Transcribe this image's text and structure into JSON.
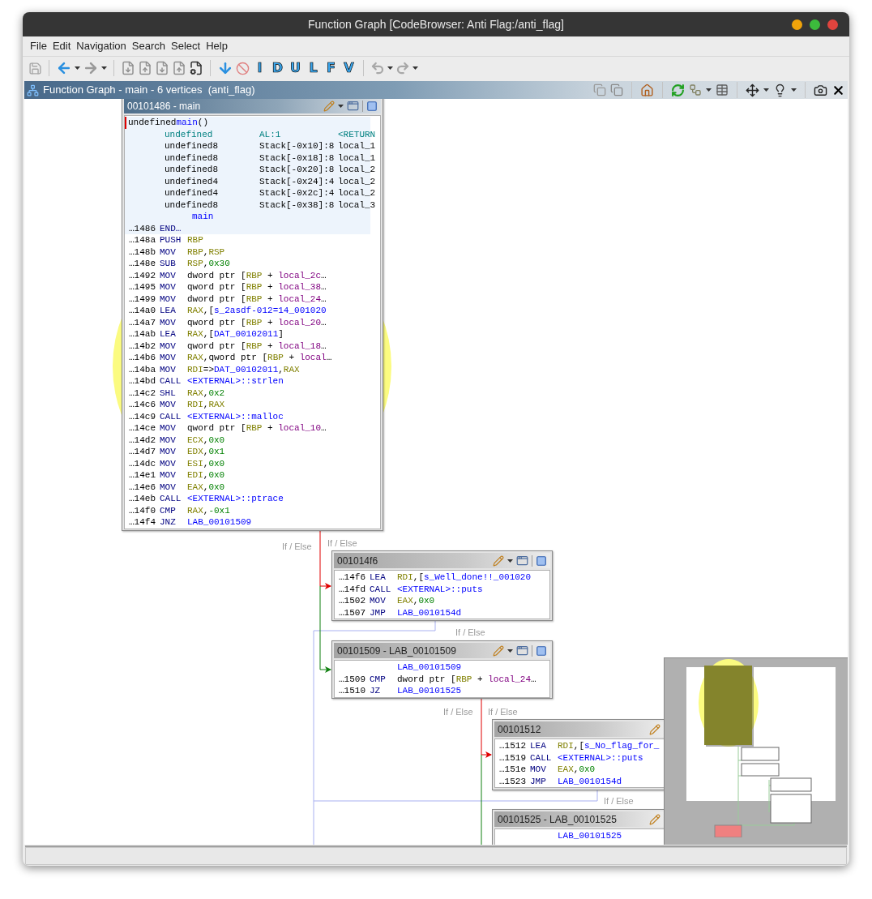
{
  "window": {
    "title": "Function Graph [CodeBrowser: Anti Flag:/anti_flag]"
  },
  "menu": [
    {
      "label": "File"
    },
    {
      "label": "Edit"
    },
    {
      "label": "Navigation"
    },
    {
      "label": "Search"
    },
    {
      "label": "Select"
    },
    {
      "label": "Help"
    }
  ],
  "toolbar": {
    "save_enabled": false,
    "forward_enabled": false,
    "undo_enabled": false,
    "redo_enabled": false,
    "letters": [
      "I",
      "D",
      "U",
      "L",
      "F",
      "V"
    ]
  },
  "panel": {
    "title": "Function Graph - main - 6 vertices  (anti_flag)"
  },
  "nodes": [
    {
      "title": "00101486 - main",
      "selected": true,
      "clipped": false,
      "signature": {
        "head": [
          {
            "kind": "text",
            "text": "undefined"
          },
          {
            "kind": "label",
            "text": "main"
          },
          {
            "kind": "text",
            "text": "()"
          }
        ],
        "params": [
          {
            "kind": "return",
            "type": "undefined",
            "storage": "AL:1",
            "name": "<RETURN"
          },
          {
            "kind": "param",
            "type": "undefined8",
            "storage": "Stack[-0x10]:8",
            "name": "local_1"
          },
          {
            "kind": "param",
            "type": "undefined8",
            "storage": "Stack[-0x18]:8",
            "name": "local_1"
          },
          {
            "kind": "param",
            "type": "undefined8",
            "storage": "Stack[-0x20]:8",
            "name": "local_2"
          },
          {
            "kind": "param",
            "type": "undefined4",
            "storage": "Stack[-0x24]:4",
            "name": "local_2"
          },
          {
            "kind": "param",
            "type": "undefined4",
            "storage": "Stack[-0x2c]:4",
            "name": "local_2"
          },
          {
            "kind": "param",
            "type": "undefined8",
            "storage": "Stack[-0x38]:8",
            "name": "local_3"
          }
        ],
        "label": "main",
        "end_addr": "…1486",
        "end_mnemonic": "END…"
      },
      "lines": [
        {
          "addr": "…148a",
          "mnemonic": "PUSH",
          "operands": [
            {
              "kind": "reg",
              "text": "RBP"
            }
          ]
        },
        {
          "addr": "…148b",
          "mnemonic": "MOV",
          "operands": [
            {
              "kind": "reg",
              "text": "RBP"
            },
            {
              "kind": "text",
              "text": ","
            },
            {
              "kind": "reg",
              "text": "RSP"
            }
          ]
        },
        {
          "addr": "…148e",
          "mnemonic": "SUB",
          "operands": [
            {
              "kind": "reg",
              "text": "RSP"
            },
            {
              "kind": "text",
              "text": ","
            },
            {
              "kind": "num",
              "text": "0x30"
            }
          ]
        },
        {
          "addr": "…1492",
          "mnemonic": "MOV",
          "operands": [
            {
              "kind": "text",
              "text": "dword ptr ["
            },
            {
              "kind": "reg",
              "text": "RBP"
            },
            {
              "kind": "text",
              "text": " + "
            },
            {
              "kind": "local",
              "text": "local_2c"
            },
            {
              "kind": "text",
              "text": "…"
            }
          ]
        },
        {
          "addr": "…1495",
          "mnemonic": "MOV",
          "operands": [
            {
              "kind": "text",
              "text": "qword ptr ["
            },
            {
              "kind": "reg",
              "text": "RBP"
            },
            {
              "kind": "text",
              "text": " + "
            },
            {
              "kind": "local",
              "text": "local_38"
            },
            {
              "kind": "text",
              "text": "…"
            }
          ]
        },
        {
          "addr": "…1499",
          "mnemonic": "MOV",
          "operands": [
            {
              "kind": "text",
              "text": "dword ptr ["
            },
            {
              "kind": "reg",
              "text": "RBP"
            },
            {
              "kind": "text",
              "text": " + "
            },
            {
              "kind": "local",
              "text": "local_24"
            },
            {
              "kind": "text",
              "text": "…"
            }
          ]
        },
        {
          "addr": "…14a0",
          "mnemonic": "LEA",
          "operands": [
            {
              "kind": "reg",
              "text": "RAX"
            },
            {
              "kind": "text",
              "text": ",["
            },
            {
              "kind": "label",
              "text": "s_2asdf-012=14_001020"
            }
          ]
        },
        {
          "addr": "…14a7",
          "mnemonic": "MOV",
          "operands": [
            {
              "kind": "text",
              "text": "qword ptr ["
            },
            {
              "kind": "reg",
              "text": "RBP"
            },
            {
              "kind": "text",
              "text": " + "
            },
            {
              "kind": "local",
              "text": "local_20"
            },
            {
              "kind": "text",
              "text": "…"
            }
          ]
        },
        {
          "addr": "…14ab",
          "mnemonic": "LEA",
          "operands": [
            {
              "kind": "reg",
              "text": "RAX"
            },
            {
              "kind": "text",
              "text": ",["
            },
            {
              "kind": "label",
              "text": "DAT_00102011"
            },
            {
              "kind": "text",
              "text": "]"
            }
          ]
        },
        {
          "addr": "…14b2",
          "mnemonic": "MOV",
          "operands": [
            {
              "kind": "text",
              "text": "qword ptr ["
            },
            {
              "kind": "reg",
              "text": "RBP"
            },
            {
              "kind": "text",
              "text": " + "
            },
            {
              "kind": "local",
              "text": "local_18"
            },
            {
              "kind": "text",
              "text": "…"
            }
          ]
        },
        {
          "addr": "…14b6",
          "mnemonic": "MOV",
          "operands": [
            {
              "kind": "reg",
              "text": "RAX"
            },
            {
              "kind": "text",
              "text": ",qword ptr ["
            },
            {
              "kind": "reg",
              "text": "RBP"
            },
            {
              "kind": "text",
              "text": " + "
            },
            {
              "kind": "local",
              "text": "local"
            },
            {
              "kind": "text",
              "text": "…"
            }
          ]
        },
        {
          "addr": "…14ba",
          "mnemonic": "MOV",
          "operands": [
            {
              "kind": "reg",
              "text": "RDI"
            },
            {
              "kind": "text",
              "text": "=>"
            },
            {
              "kind": "label",
              "text": "DAT_00102011"
            },
            {
              "kind": "text",
              "text": ","
            },
            {
              "kind": "reg",
              "text": "RAX"
            }
          ]
        },
        {
          "addr": "…14bd",
          "mnemonic": "CALL",
          "operands": [
            {
              "kind": "label",
              "text": "<EXTERNAL>::strlen"
            }
          ]
        },
        {
          "addr": "…14c2",
          "mnemonic": "SHL",
          "operands": [
            {
              "kind": "reg",
              "text": "RAX"
            },
            {
              "kind": "text",
              "text": ","
            },
            {
              "kind": "num",
              "text": "0x2"
            }
          ]
        },
        {
          "addr": "…14c6",
          "mnemonic": "MOV",
          "operands": [
            {
              "kind": "reg",
              "text": "RDI"
            },
            {
              "kind": "text",
              "text": ","
            },
            {
              "kind": "reg",
              "text": "RAX"
            }
          ]
        },
        {
          "addr": "…14c9",
          "mnemonic": "CALL",
          "operands": [
            {
              "kind": "label",
              "text": "<EXTERNAL>::malloc"
            }
          ]
        },
        {
          "addr": "…14ce",
          "mnemonic": "MOV",
          "operands": [
            {
              "kind": "text",
              "text": "qword ptr ["
            },
            {
              "kind": "reg",
              "text": "RBP"
            },
            {
              "kind": "text",
              "text": " + "
            },
            {
              "kind": "local",
              "text": "local_10"
            },
            {
              "kind": "text",
              "text": "…"
            }
          ]
        },
        {
          "addr": "…14d2",
          "mnemonic": "MOV",
          "operands": [
            {
              "kind": "reg",
              "text": "ECX"
            },
            {
              "kind": "text",
              "text": ","
            },
            {
              "kind": "num",
              "text": "0x0"
            }
          ]
        },
        {
          "addr": "…14d7",
          "mnemonic": "MOV",
          "operands": [
            {
              "kind": "reg",
              "text": "EDX"
            },
            {
              "kind": "text",
              "text": ","
            },
            {
              "kind": "num",
              "text": "0x1"
            }
          ]
        },
        {
          "addr": "…14dc",
          "mnemonic": "MOV",
          "operands": [
            {
              "kind": "reg",
              "text": "ESI"
            },
            {
              "kind": "text",
              "text": ","
            },
            {
              "kind": "num",
              "text": "0x0"
            }
          ]
        },
        {
          "addr": "…14e1",
          "mnemonic": "MOV",
          "operands": [
            {
              "kind": "reg",
              "text": "EDI"
            },
            {
              "kind": "text",
              "text": ","
            },
            {
              "kind": "num",
              "text": "0x0"
            }
          ]
        },
        {
          "addr": "…14e6",
          "mnemonic": "MOV",
          "operands": [
            {
              "kind": "reg",
              "text": "EAX"
            },
            {
              "kind": "text",
              "text": ","
            },
            {
              "kind": "num",
              "text": "0x0"
            }
          ]
        },
        {
          "addr": "…14eb",
          "mnemonic": "CALL",
          "operands": [
            {
              "kind": "label",
              "text": "<EXTERNAL>::ptrace"
            }
          ]
        },
        {
          "addr": "…14f0",
          "mnemonic": "CMP",
          "operands": [
            {
              "kind": "reg",
              "text": "RAX"
            },
            {
              "kind": "text",
              "text": ","
            },
            {
              "kind": "num",
              "text": "-0x1"
            }
          ]
        },
        {
          "addr": "…14f4",
          "mnemonic": "JNZ",
          "operands": [
            {
              "kind": "label",
              "text": "LAB_00101509"
            }
          ]
        }
      ]
    },
    {
      "title": "001014f6",
      "selected": false,
      "clipped": false,
      "lines": [
        {
          "addr": "…14f6",
          "mnemonic": "LEA",
          "operands": [
            {
              "kind": "reg",
              "text": "RDI"
            },
            {
              "kind": "text",
              "text": ",["
            },
            {
              "kind": "label",
              "text": "s_Well_done!!_001020"
            }
          ]
        },
        {
          "addr": "…14fd",
          "mnemonic": "CALL",
          "operands": [
            {
              "kind": "label",
              "text": "<EXTERNAL>::puts"
            }
          ]
        },
        {
          "addr": "…1502",
          "mnemonic": "MOV",
          "operands": [
            {
              "kind": "reg",
              "text": "EAX"
            },
            {
              "kind": "text",
              "text": ","
            },
            {
              "kind": "num",
              "text": "0x0"
            }
          ]
        },
        {
          "addr": "…1507",
          "mnemonic": "JMP",
          "operands": [
            {
              "kind": "label",
              "text": "LAB_0010154d"
            }
          ]
        }
      ]
    },
    {
      "title": "00101509 - LAB_00101509",
      "selected": false,
      "clipped": false,
      "lines": [
        {
          "operands": [
            {
              "kind": "label",
              "text": "LAB_00101509"
            }
          ]
        },
        {
          "addr": "…1509",
          "mnemonic": "CMP",
          "operands": [
            {
              "kind": "text",
              "text": "dword ptr ["
            },
            {
              "kind": "reg",
              "text": "RBP"
            },
            {
              "kind": "text",
              "text": " + "
            },
            {
              "kind": "local",
              "text": "local_24"
            },
            {
              "kind": "text",
              "text": "…"
            }
          ]
        },
        {
          "addr": "…1510",
          "mnemonic": "JZ",
          "operands": [
            {
              "kind": "label",
              "text": "LAB_00101525"
            }
          ]
        }
      ]
    },
    {
      "title": "00101512",
      "selected": false,
      "clipped": true,
      "lines": [
        {
          "addr": "…1512",
          "mnemonic": "LEA",
          "operands": [
            {
              "kind": "reg",
              "text": "RDI"
            },
            {
              "kind": "text",
              "text": ",["
            },
            {
              "kind": "label",
              "text": "s_No_flag_for_"
            }
          ]
        },
        {
          "addr": "…1519",
          "mnemonic": "CALL",
          "operands": [
            {
              "kind": "label",
              "text": "<EXTERNAL>::puts"
            }
          ]
        },
        {
          "addr": "…151e",
          "mnemonic": "MOV",
          "operands": [
            {
              "kind": "reg",
              "text": "EAX"
            },
            {
              "kind": "text",
              "text": ","
            },
            {
              "kind": "num",
              "text": "0x0"
            }
          ]
        },
        {
          "addr": "…1523",
          "mnemonic": "JMP",
          "operands": [
            {
              "kind": "label",
              "text": "LAB_0010154d"
            }
          ]
        }
      ]
    },
    {
      "title": "00101525 - LAB_00101525",
      "selected": false,
      "clipped": true,
      "lines": [
        {
          "operands": [
            {
              "kind": "label",
              "text": "LAB_00101525"
            }
          ]
        }
      ]
    }
  ],
  "edge_labels": [
    "If / Else",
    "If / Else",
    "If / Else",
    "If / Else",
    "If / Else",
    "If / Else"
  ]
}
